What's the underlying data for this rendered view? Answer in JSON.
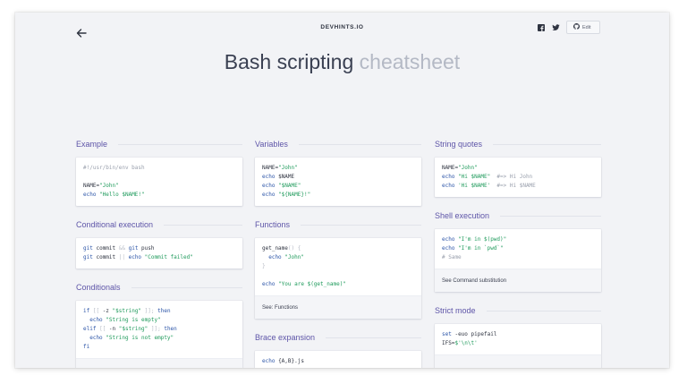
{
  "header": {
    "brand": "DEVHINTS.IO",
    "title_main": "Bash scripting",
    "title_muted": "cheatsheet",
    "edit_label": "Edit"
  },
  "icons": {
    "back": "arrow-left-icon",
    "facebook": "facebook-icon",
    "twitter": "twitter-icon",
    "github": "github-icon"
  },
  "colors": {
    "accent": "#5e55a8",
    "keyword": "#2c55a8",
    "string": "#1e9a5b",
    "comment": "#9aa0ad",
    "background": "#f2f3f6"
  },
  "sections": {
    "example": {
      "title": "Example",
      "l1": "#!/usr/bin/env bash",
      "l2a": "NAME=",
      "l2b": "\"John\"",
      "l3a": "echo",
      "l3b": " \"Hello $NAME!\""
    },
    "conditional_execution": {
      "title": "Conditional execution",
      "l1a": "git",
      "l1b": " commit ",
      "l1c": "&&",
      "l1d": " git",
      "l1e": " push",
      "l2a": "git",
      "l2b": " commit ",
      "l2c": "||",
      "l2d": " echo",
      "l2e": " \"Commit failed\""
    },
    "conditionals": {
      "title": "Conditionals",
      "l1a": "if",
      "l1b": " [[ ",
      "l1c": "-z",
      "l1d": " \"$string\"",
      "l1e": " ]]; ",
      "l1f": "then",
      "l2a": "  echo",
      "l2b": " \"String is empty\"",
      "l3a": "elif",
      "l3b": " [[ ",
      "l3c": "-n",
      "l3d": " \"$string\"",
      "l3e": " ]]; ",
      "l3f": "then",
      "l4a": "  echo",
      "l4b": " \"String is not empty\"",
      "l5a": "fi"
    },
    "variables": {
      "title": "Variables",
      "l1a": "NAME=",
      "l1b": "\"John\"",
      "l2a": "echo",
      "l2b": " $NAME",
      "l3a": "echo",
      "l3b": " \"$NAME\"",
      "l4a": "echo",
      "l4b": " \"${NAME}!\""
    },
    "functions": {
      "title": "Functions",
      "l1a": "get_name",
      "l1b": "() {",
      "l2a": "  echo",
      "l2b": " \"John\"",
      "l3a": "}",
      "l4a": "echo",
      "l4b": " \"You are $(get_name)\"",
      "footer": "See: Functions"
    },
    "brace_expansion": {
      "title": "Brace expansion",
      "l1a": "echo",
      "l1b": " {A,B}.js"
    },
    "string_quotes": {
      "title": "String quotes",
      "l1a": "NAME=",
      "l1b": "\"John\"",
      "l2a": "echo",
      "l2b": " \"Hi $NAME\"",
      "l2c": "  #=> Hi John",
      "l3a": "echo",
      "l3b": " 'Hi $NAME'",
      "l3c": "  #=> Hi $NAME"
    },
    "shell_execution": {
      "title": "Shell execution",
      "l1a": "echo",
      "l1b": " \"I'm in $(pwd)\"",
      "l2a": "echo",
      "l2b": " \"I'm in `pwd`\"",
      "l3a": "# Same",
      "footer": "See Command substitution"
    },
    "strict_mode": {
      "title": "Strict mode",
      "l1a": "set",
      "l1b": " -euo pipefail",
      "l2a": "IFS=",
      "l2b": "$'\\n\\t'"
    }
  }
}
